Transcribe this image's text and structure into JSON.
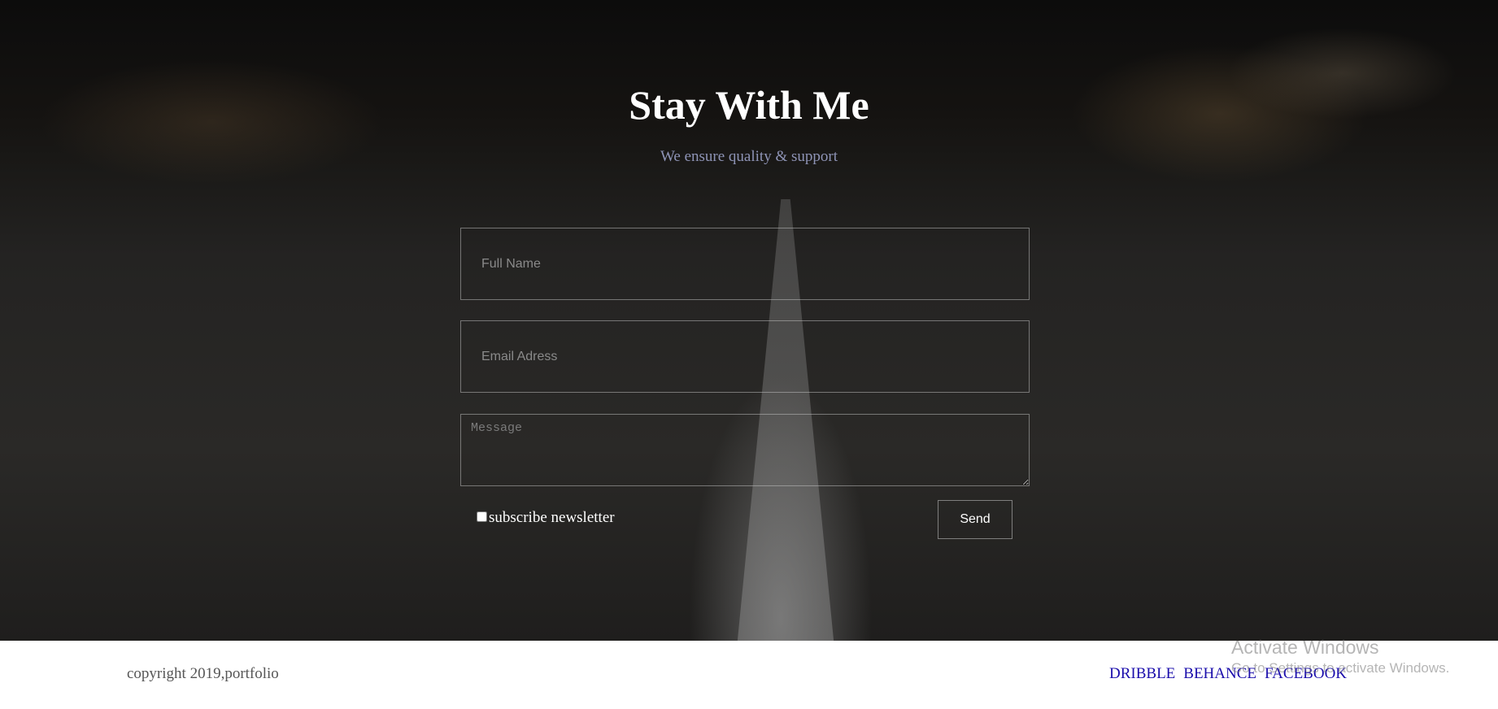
{
  "hero": {
    "title": "Stay With Me",
    "subtitle": "We ensure quality & support"
  },
  "form": {
    "name_placeholder": "Full Name",
    "email_placeholder": "Email Adress",
    "message_placeholder": "Message",
    "subscribe_label": "subscribe newsletter",
    "subscribe_checked": false,
    "send_label": "Send"
  },
  "footer": {
    "copyright": "copyright 2019,portfolio",
    "links": [
      "DRIBBLE",
      "BEHANCE",
      "FACEBOOK"
    ]
  },
  "watermark": {
    "line1": "Activate Windows",
    "line2": "Go to Settings to activate Windows."
  },
  "colors": {
    "subtitle": "#8e94b6",
    "link": "#1a0dab"
  }
}
